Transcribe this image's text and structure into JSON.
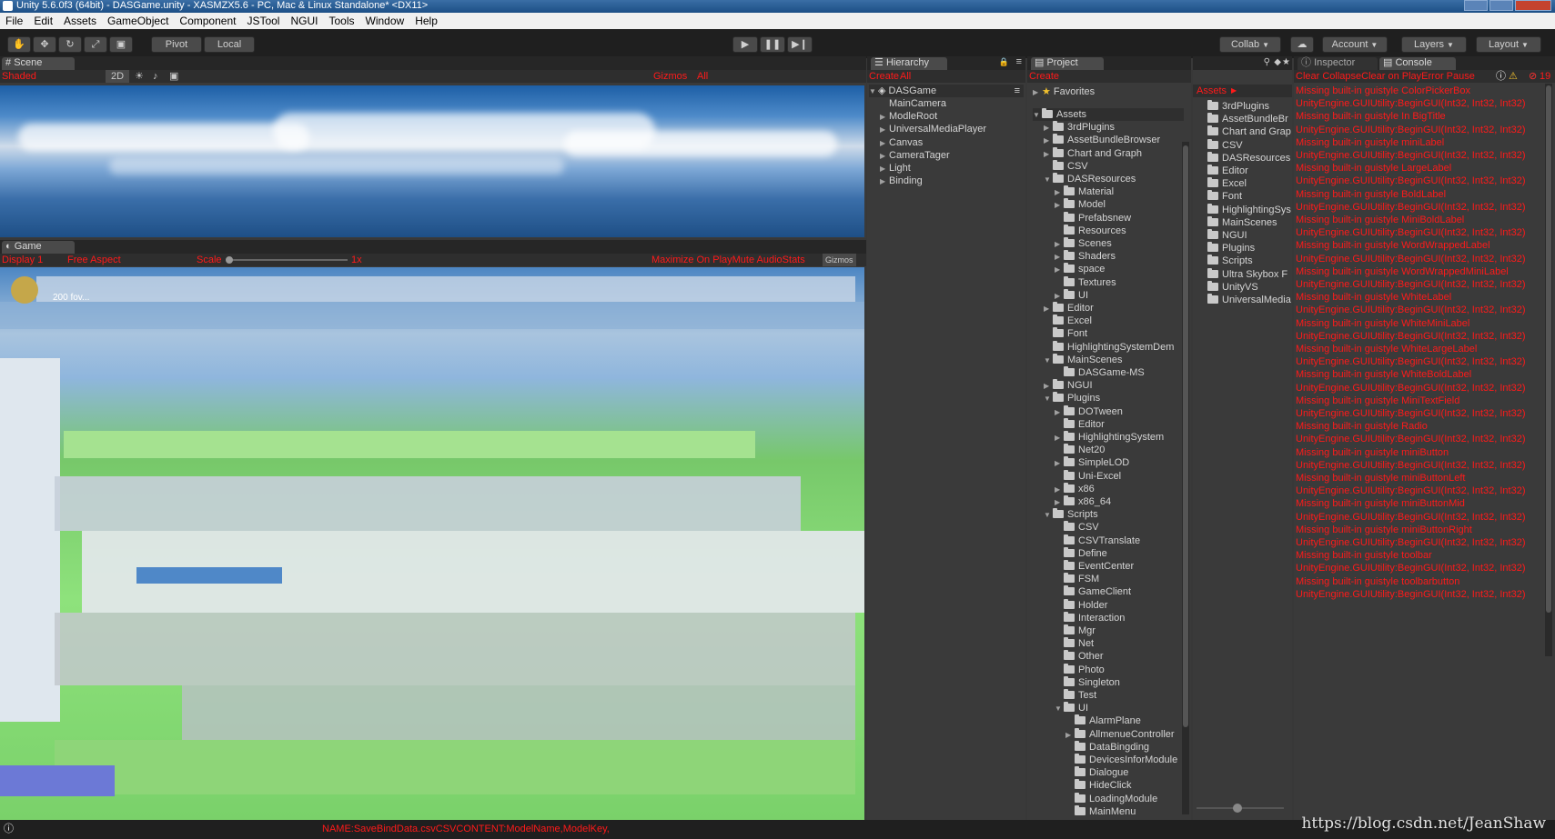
{
  "window": {
    "title": "Unity 5.6.0f3 (64bit) - DASGame.unity - XASMZX5.6 - PC, Mac & Linux Standalone* <DX11>"
  },
  "menu": [
    "File",
    "Edit",
    "Assets",
    "GameObject",
    "Component",
    "JSTool",
    "NGUI",
    "Tools",
    "Window",
    "Help"
  ],
  "toolbar": {
    "pivot": "Pivot",
    "local": "Local",
    "collab": "Collab",
    "account": "Account",
    "layers": "Layers",
    "layout": "Layout"
  },
  "scene": {
    "tab": "Scene",
    "shaded": "Shaded",
    "mode2d": "2D",
    "gizmos": "Gizmos",
    "all": "All"
  },
  "game": {
    "tab": "Game",
    "display": "Display 1",
    "aspect": "Free Aspect",
    "scale_label": "Scale",
    "scale_value": "1x",
    "toggles": "Maximize On PlayMute AudioStats",
    "gizmos": "Gizmos",
    "overlay": "200 fov..."
  },
  "hierarchy": {
    "tab": "Hierarchy",
    "create": "Create",
    "all": "All",
    "scene": "DASGame",
    "items": [
      {
        "label": "MainCamera",
        "arrow": ""
      },
      {
        "label": "ModleRoot",
        "arrow": "▶"
      },
      {
        "label": "UniversalMediaPlayer",
        "arrow": "▶"
      },
      {
        "label": "Canvas",
        "arrow": "▶"
      },
      {
        "label": "CameraTager",
        "arrow": "▶"
      },
      {
        "label": "Light",
        "arrow": "▶"
      },
      {
        "label": "Binding",
        "arrow": "▶"
      }
    ]
  },
  "project": {
    "tab": "Project",
    "create": "Create",
    "favorites": "Favorites",
    "tree": [
      {
        "label": "Assets",
        "depth": 0,
        "arrow": "▼"
      },
      {
        "label": "3rdPlugins",
        "depth": 1,
        "arrow": "▶"
      },
      {
        "label": "AssetBundleBrowser",
        "depth": 1,
        "arrow": "▶"
      },
      {
        "label": "Chart and Graph",
        "depth": 1,
        "arrow": "▶"
      },
      {
        "label": "CSV",
        "depth": 1,
        "arrow": ""
      },
      {
        "label": "DASResources",
        "depth": 1,
        "arrow": "▼"
      },
      {
        "label": "Material",
        "depth": 2,
        "arrow": "▶"
      },
      {
        "label": "Model",
        "depth": 2,
        "arrow": "▶"
      },
      {
        "label": "Prefabsnew",
        "depth": 2,
        "arrow": ""
      },
      {
        "label": "Resources",
        "depth": 2,
        "arrow": ""
      },
      {
        "label": "Scenes",
        "depth": 2,
        "arrow": "▶"
      },
      {
        "label": "Shaders",
        "depth": 2,
        "arrow": "▶"
      },
      {
        "label": "space",
        "depth": 2,
        "arrow": "▶"
      },
      {
        "label": "Textures",
        "depth": 2,
        "arrow": ""
      },
      {
        "label": "UI",
        "depth": 2,
        "arrow": "▶"
      },
      {
        "label": "Editor",
        "depth": 1,
        "arrow": "▶"
      },
      {
        "label": "Excel",
        "depth": 1,
        "arrow": ""
      },
      {
        "label": "Font",
        "depth": 1,
        "arrow": ""
      },
      {
        "label": "HighlightingSystemDem",
        "depth": 1,
        "arrow": ""
      },
      {
        "label": "MainScenes",
        "depth": 1,
        "arrow": "▼"
      },
      {
        "label": "DASGame-MS",
        "depth": 2,
        "arrow": ""
      },
      {
        "label": "NGUI",
        "depth": 1,
        "arrow": "▶"
      },
      {
        "label": "Plugins",
        "depth": 1,
        "arrow": "▼"
      },
      {
        "label": "DOTween",
        "depth": 2,
        "arrow": "▶"
      },
      {
        "label": "Editor",
        "depth": 2,
        "arrow": ""
      },
      {
        "label": "HighlightingSystem",
        "depth": 2,
        "arrow": "▶"
      },
      {
        "label": "Net20",
        "depth": 2,
        "arrow": ""
      },
      {
        "label": "SimpleLOD",
        "depth": 2,
        "arrow": "▶"
      },
      {
        "label": "Uni-Excel",
        "depth": 2,
        "arrow": ""
      },
      {
        "label": "x86",
        "depth": 2,
        "arrow": "▶"
      },
      {
        "label": "x86_64",
        "depth": 2,
        "arrow": "▶"
      },
      {
        "label": "Scripts",
        "depth": 1,
        "arrow": "▼"
      },
      {
        "label": "CSV",
        "depth": 2,
        "arrow": ""
      },
      {
        "label": "CSVTranslate",
        "depth": 2,
        "arrow": ""
      },
      {
        "label": "Define",
        "depth": 2,
        "arrow": ""
      },
      {
        "label": "EventCenter",
        "depth": 2,
        "arrow": ""
      },
      {
        "label": "FSM",
        "depth": 2,
        "arrow": ""
      },
      {
        "label": "GameClient",
        "depth": 2,
        "arrow": ""
      },
      {
        "label": "Holder",
        "depth": 2,
        "arrow": ""
      },
      {
        "label": "Interaction",
        "depth": 2,
        "arrow": ""
      },
      {
        "label": "Mgr",
        "depth": 2,
        "arrow": ""
      },
      {
        "label": "Net",
        "depth": 2,
        "arrow": ""
      },
      {
        "label": "Other",
        "depth": 2,
        "arrow": ""
      },
      {
        "label": "Photo",
        "depth": 2,
        "arrow": ""
      },
      {
        "label": "Singleton",
        "depth": 2,
        "arrow": ""
      },
      {
        "label": "Test",
        "depth": 2,
        "arrow": ""
      },
      {
        "label": "UI",
        "depth": 2,
        "arrow": "▼"
      },
      {
        "label": "AlarmPlane",
        "depth": 3,
        "arrow": ""
      },
      {
        "label": "AllmenueController",
        "depth": 3,
        "arrow": "▶"
      },
      {
        "label": "DataBingding",
        "depth": 3,
        "arrow": ""
      },
      {
        "label": "DevicesInforModule",
        "depth": 3,
        "arrow": ""
      },
      {
        "label": "Dialogue",
        "depth": 3,
        "arrow": ""
      },
      {
        "label": "HideClick",
        "depth": 3,
        "arrow": ""
      },
      {
        "label": "LoadingModule",
        "depth": 3,
        "arrow": ""
      },
      {
        "label": "MainMenu",
        "depth": 3,
        "arrow": ""
      }
    ],
    "assets_label": "Assets",
    "assets_list": [
      "3rdPlugins",
      "AssetBundleBr",
      "Chart and Grap",
      "CSV",
      "DASResources",
      "Editor",
      "Excel",
      "Font",
      "HighlightingSys",
      "MainScenes",
      "NGUI",
      "Plugins",
      "Scripts",
      "Ultra Skybox F",
      "UnityVS",
      "UniversalMedia"
    ]
  },
  "console": {
    "tab_inspector": "Inspector",
    "tab_console": "Console",
    "toolbar": "Clear CollapseClear on PlayError Pause",
    "error_count": "19",
    "lines": [
      "Missing built-in guistyle ColorPickerBox",
      "UnityEngine.GUIUtility:BeginGUI(Int32, Int32, Int32)",
      "Missing built-in guistyle In BigTitle",
      "UnityEngine.GUIUtility:BeginGUI(Int32, Int32, Int32)",
      "Missing built-in guistyle miniLabel",
      "UnityEngine.GUIUtility:BeginGUI(Int32, Int32, Int32)",
      "Missing built-in guistyle LargeLabel",
      "UnityEngine.GUIUtility:BeginGUI(Int32, Int32, Int32)",
      "Missing built-in guistyle BoldLabel",
      "UnityEngine.GUIUtility:BeginGUI(Int32, Int32, Int32)",
      "Missing built-in guistyle MiniBoldLabel",
      "UnityEngine.GUIUtility:BeginGUI(Int32, Int32, Int32)",
      "Missing built-in guistyle WordWrappedLabel",
      "UnityEngine.GUIUtility:BeginGUI(Int32, Int32, Int32)",
      "Missing built-in guistyle WordWrappedMiniLabel",
      "UnityEngine.GUIUtility:BeginGUI(Int32, Int32, Int32)",
      "Missing built-in guistyle WhiteLabel",
      "UnityEngine.GUIUtility:BeginGUI(Int32, Int32, Int32)",
      "Missing built-in guistyle WhiteMiniLabel",
      "UnityEngine.GUIUtility:BeginGUI(Int32, Int32, Int32)",
      "Missing built-in guistyle WhiteLargeLabel",
      "UnityEngine.GUIUtility:BeginGUI(Int32, Int32, Int32)",
      "Missing built-in guistyle WhiteBoldLabel",
      "UnityEngine.GUIUtility:BeginGUI(Int32, Int32, Int32)",
      "Missing built-in guistyle MiniTextField",
      "UnityEngine.GUIUtility:BeginGUI(Int32, Int32, Int32)",
      "Missing built-in guistyle Radio",
      "UnityEngine.GUIUtility:BeginGUI(Int32, Int32, Int32)",
      "Missing built-in guistyle miniButton",
      "UnityEngine.GUIUtility:BeginGUI(Int32, Int32, Int32)",
      "Missing built-in guistyle miniButtonLeft",
      "UnityEngine.GUIUtility:BeginGUI(Int32, Int32, Int32)",
      "Missing built-in guistyle miniButtonMid",
      "UnityEngine.GUIUtility:BeginGUI(Int32, Int32, Int32)",
      "Missing built-in guistyle miniButtonRight",
      "UnityEngine.GUIUtility:BeginGUI(Int32, Int32, Int32)",
      "Missing built-in guistyle toolbar",
      "UnityEngine.GUIUtility:BeginGUI(Int32, Int32, Int32)",
      "Missing built-in guistyle toolbarbutton",
      "UnityEngine.GUIUtility:BeginGUI(Int32, Int32, Int32)"
    ]
  },
  "status": {
    "message": "NAME:SaveBindData.csvCSVCONTENT:ModelName,ModelKey,"
  },
  "watermark": "https://blog.csdn.net/JeanShaw"
}
